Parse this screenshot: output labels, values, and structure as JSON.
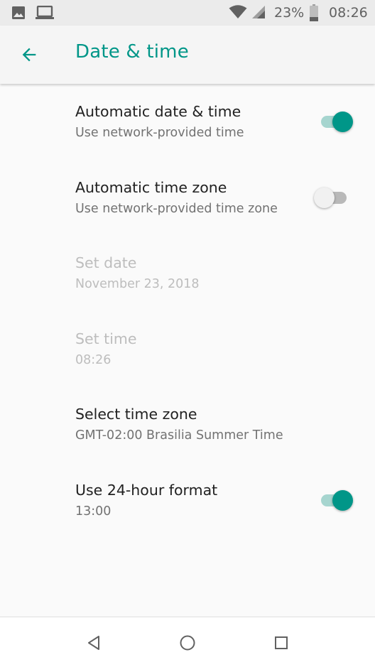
{
  "status_bar": {
    "battery_percent": "23%",
    "time": "08:26",
    "icons": [
      "image-icon",
      "laptop-icon",
      "wifi-icon",
      "signal-icon",
      "battery-icon"
    ]
  },
  "header": {
    "title": "Date & time",
    "back_icon": "arrow-back-icon"
  },
  "settings": [
    {
      "title": "Automatic date & time",
      "summary": "Use network-provided time",
      "toggle": true,
      "enabled": true
    },
    {
      "title": "Automatic time zone",
      "summary": "Use network-provided time zone",
      "toggle": false,
      "enabled": true
    },
    {
      "title": "Set date",
      "summary": "November 23, 2018",
      "enabled": false
    },
    {
      "title": "Set time",
      "summary": "08:26",
      "enabled": false
    },
    {
      "title": "Select time zone",
      "summary": "GMT-02:00 Brasilia Summer Time",
      "enabled": true
    },
    {
      "title": "Use 24-hour format",
      "summary": "13:00",
      "toggle": true,
      "enabled": true
    }
  ],
  "nav_bar": {
    "icons": [
      "back-triangle-icon",
      "home-circle-icon",
      "recents-square-icon"
    ]
  },
  "colors": {
    "accent": "#009688",
    "accent_track": "#a6d5cf",
    "disabled_text": "#bdbdbd"
  }
}
